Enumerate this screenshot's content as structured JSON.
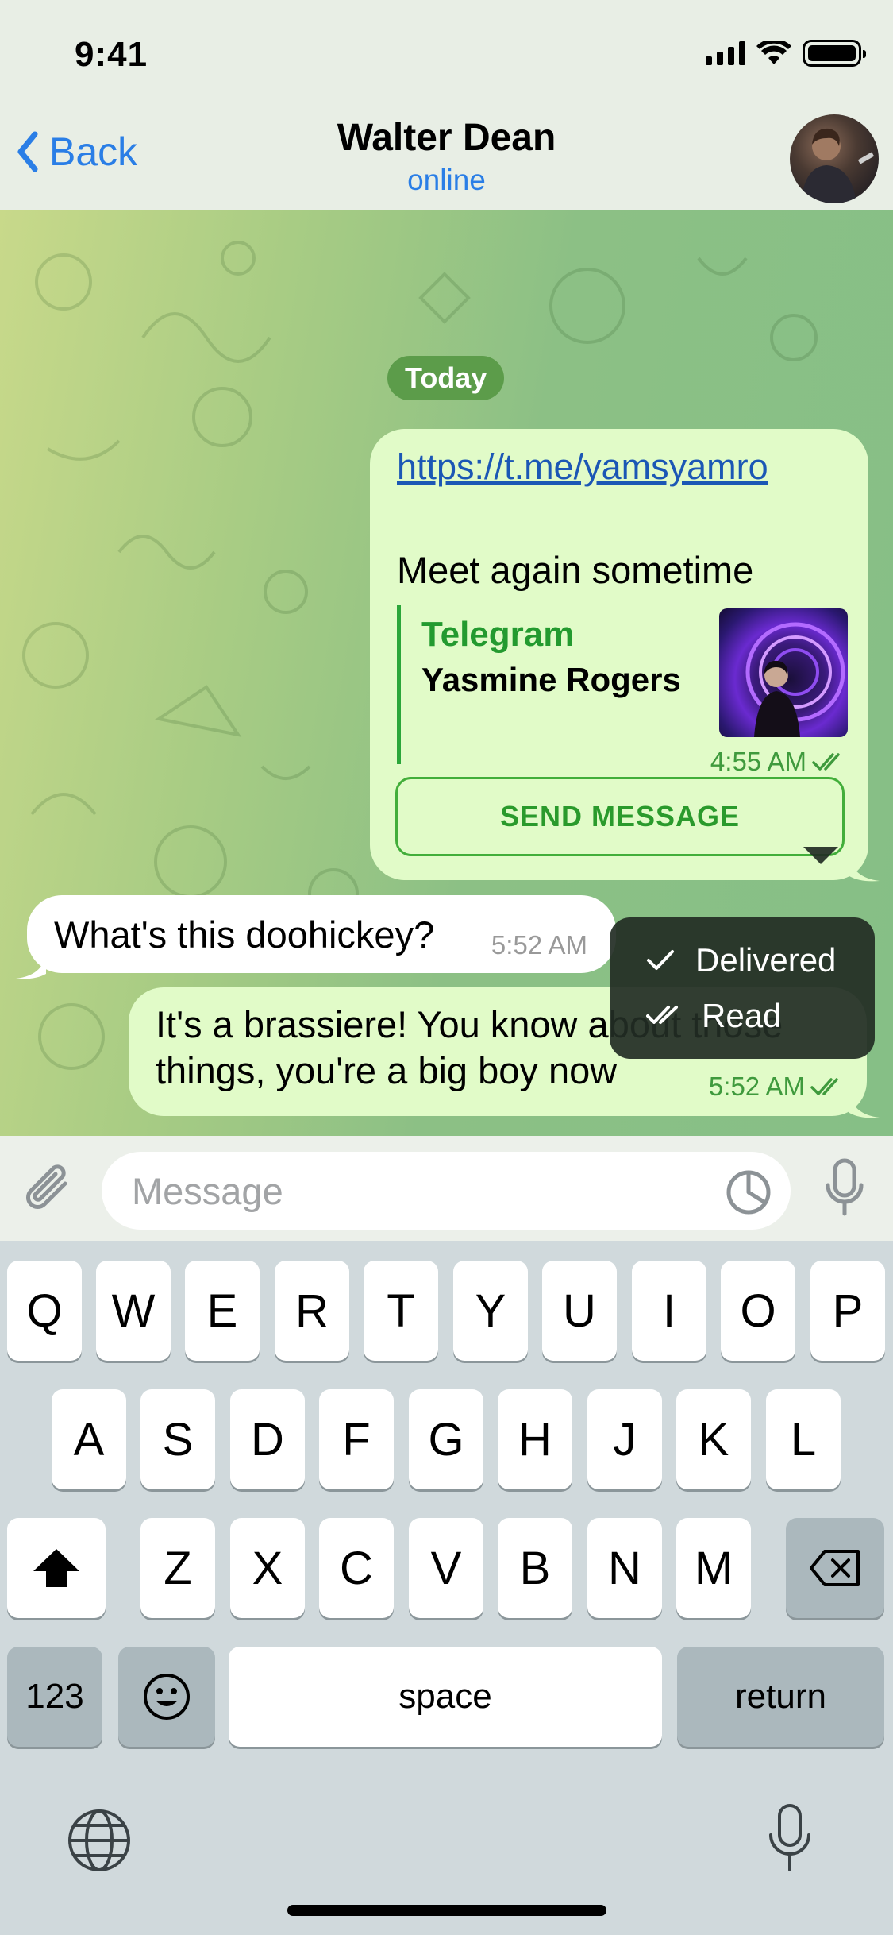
{
  "status_bar": {
    "time": "9:41"
  },
  "nav": {
    "back_label": "Back",
    "contact_name": "Walter Dean",
    "contact_status": "online"
  },
  "chat": {
    "date_label": "Today",
    "messages": [
      {
        "link": "https://t.me/yamsyamro",
        "text": "Meet again sometime",
        "preview_site": "Telegram",
        "preview_title": "Yasmine Rogers",
        "time": "4:55 AM",
        "button_label": "SEND MESSAGE"
      },
      {
        "text": "What's this doohickey?",
        "time": "5:52 AM"
      },
      {
        "line1": "It's a brassiere! You know about those",
        "line2": "things, you're a big boy now",
        "time": "5:52 AM"
      }
    ],
    "status_popup": {
      "delivered_label": "Delivered",
      "read_label": "Read"
    }
  },
  "input": {
    "placeholder": "Message",
    "value": ""
  },
  "keyboard": {
    "row1": [
      "Q",
      "W",
      "E",
      "R",
      "T",
      "Y",
      "U",
      "I",
      "O",
      "P"
    ],
    "row2": [
      "A",
      "S",
      "D",
      "F",
      "G",
      "H",
      "J",
      "K",
      "L"
    ],
    "row3": [
      "Z",
      "X",
      "C",
      "V",
      "B",
      "N",
      "M"
    ],
    "numbers_label": "123",
    "space_label": "space",
    "return_label": "return"
  },
  "colors": {
    "accent": "#2a7ee6",
    "outgoing_bubble": "#e1fbc8",
    "incoming_bubble": "#ffffff",
    "green_text": "#239a2f"
  }
}
